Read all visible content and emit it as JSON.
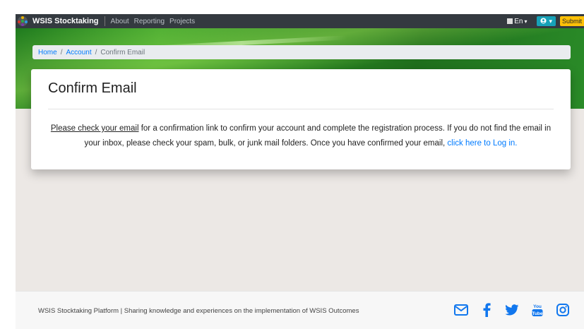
{
  "navbar": {
    "brand": "WSIS Stocktaking",
    "links": [
      "About",
      "Reporting",
      "Projects"
    ],
    "language": "En",
    "user_caret": "▾",
    "submit_label": "Submit"
  },
  "breadcrumb": {
    "home": "Home",
    "account": "Account",
    "current": "Confirm Email",
    "separator": "/"
  },
  "card": {
    "title": "Confirm Email",
    "message_link_1": "Please check your email",
    "message_mid": " for a confirmation link to confirm your account and complete the registration process. If you do not find the email in your inbox, please check your spam, bulk, or junk mail folders. Once you have confirmed your email, ",
    "message_link_2": "click here to Log in."
  },
  "footer": {
    "text": "WSIS Stocktaking Platform | Sharing knowledge and experiences on the implementation of WSIS Outcomes",
    "icons": [
      "email-icon",
      "facebook-icon",
      "twitter-icon",
      "youtube-icon",
      "instagram-icon"
    ]
  },
  "colors": {
    "navbar": "#343a40",
    "accent": "#007bff",
    "submit": "#ffc107",
    "user_button": "#17a2b8",
    "banner_green": "#2d8a24",
    "social_blue": "#1177ee"
  }
}
